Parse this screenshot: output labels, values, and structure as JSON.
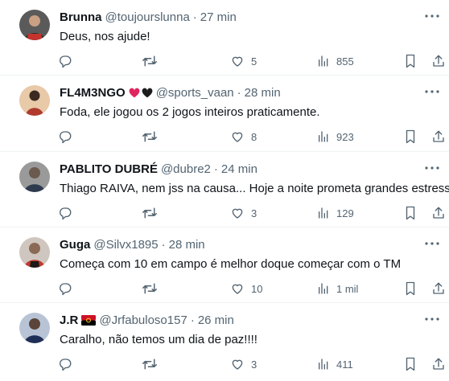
{
  "replies": [
    {
      "name": "Brunna",
      "badges": [],
      "handle": "@toujourslunna",
      "time": "27 min",
      "text": "Deus, nos ajude!",
      "reply_count": "",
      "retweet_count": "",
      "like_count": "5",
      "view_count": "855",
      "avatar_colors": [
        "#2b2b2b",
        "#c4342d"
      ]
    },
    {
      "name": "FL4M3NGO",
      "badges": [
        "heart-red",
        "heart-black"
      ],
      "handle": "@sports_vaan",
      "time": "28 min",
      "text": "Foda, ele jogou os 2 jogos inteiros praticamente.",
      "reply_count": "",
      "retweet_count": "",
      "like_count": "8",
      "view_count": "923",
      "avatar_colors": [
        "#3a2a22",
        "#b03a2e"
      ]
    },
    {
      "name": "PABLITO DUBRÉ",
      "badges": [],
      "handle": "@dubre2",
      "time": "24 min",
      "text": "Thiago RAIVA, nem jss na causa... Hoje a noite prometa grandes estresses",
      "reply_count": "",
      "retweet_count": "",
      "like_count": "3",
      "view_count": "129",
      "avatar_colors": [
        "#6b6b6b",
        "#2e3b4e"
      ]
    },
    {
      "name": "Guga",
      "badges": [],
      "handle": "@Silvx1895",
      "time": "28 min",
      "text": "Começa com 10 em campo é melhor doque começar com o TM",
      "reply_count": "",
      "retweet_count": "",
      "like_count": "10",
      "view_count": "1 mil",
      "avatar_colors": [
        "#8a6a55",
        "#c0392b"
      ]
    },
    {
      "name": "J.R",
      "badges": [
        "flag-angola"
      ],
      "handle": "@Jrfabuloso157",
      "time": "26 min",
      "text": "Caralho, não temos um dia de paz!!!!",
      "reply_count": "",
      "retweet_count": "",
      "like_count": "3",
      "view_count": "411",
      "avatar_colors": [
        "#3a4a6a",
        "#1f2f55"
      ]
    }
  ],
  "colors": {
    "text_primary": "#0f1419",
    "text_secondary": "#536471",
    "divider": "#eff3f4",
    "heart_red": "#e0245e",
    "heart_black": "#1c1c1c",
    "flag_red": "#ce1126",
    "flag_black": "#000000",
    "flag_emblem": "#f9d616"
  },
  "icons": {
    "reply": "reply-icon",
    "retweet": "retweet-icon",
    "like": "heart-icon",
    "views": "views-icon",
    "bookmark": "bookmark-icon",
    "share": "share-icon",
    "more": "more-icon"
  }
}
